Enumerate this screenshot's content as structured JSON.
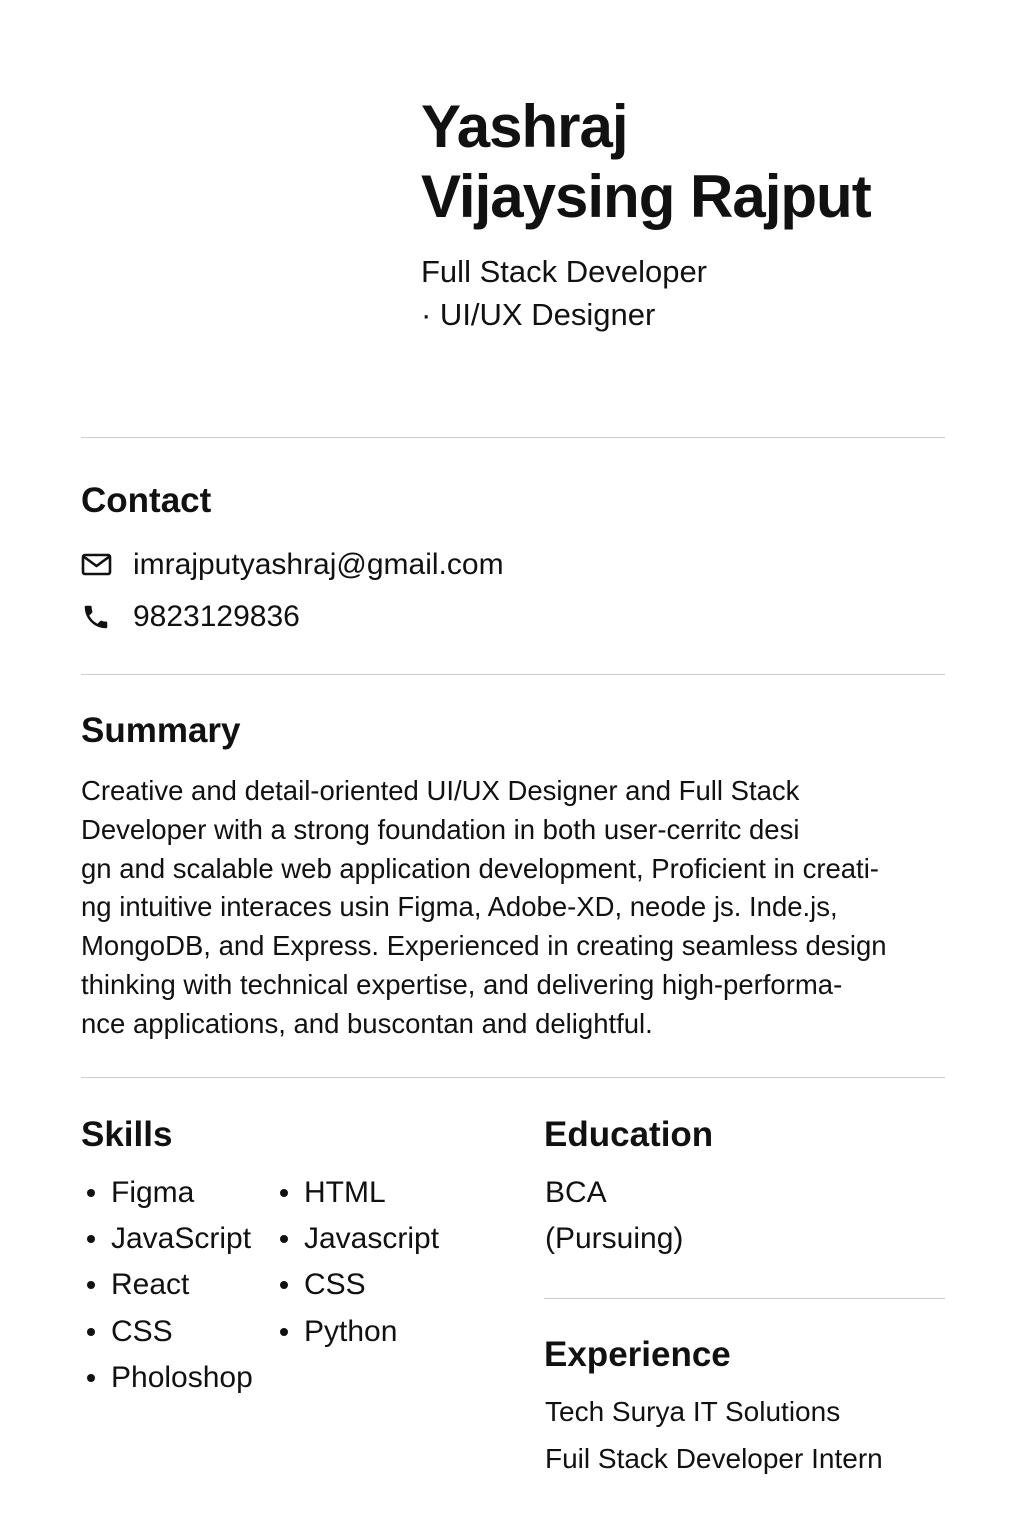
{
  "header": {
    "name_line1": "Yashraj",
    "name_line2": "Vijaysing Rajput",
    "title_line1": "Full Stack Developer",
    "title_line2": "· UI/UX Designer"
  },
  "contact": {
    "heading": "Contact",
    "email": "imrajputyashraj@gmail.com",
    "email_icon": "mail-icon",
    "phone": "9823129836",
    "phone_icon": "phone-icon"
  },
  "summary": {
    "heading": "Summary",
    "lines": [
      "Creative and detail-oriented UI/UX Designer and Full Stack",
      "Developer with a strong foundation in both user-cerritc desi",
      "gn and scalable web application development, Proficient in creati-",
      "ng intuitive interaces usin Figma, Adobe-XD, neode js. Inde.js,",
      "MongoDB, and Express. Experienced in creating seamless design",
      "thinking with technical expertise, and delivering high-performa-",
      "nce applications, and buscontan and delightful."
    ]
  },
  "skills": {
    "heading": "Skills",
    "col1": [
      "Figma",
      "JavaScript",
      "React",
      "CSS",
      "Pholoshop"
    ],
    "col2": [
      "HTML",
      "Javascript",
      "CSS",
      "Python"
    ]
  },
  "education": {
    "heading": "Education",
    "degree": "BCA",
    "status": "(Pursuing)"
  },
  "experience": {
    "heading": "Experience",
    "company": "Tech Surya IT Solutions",
    "role": "Fuil Stack Developer  Intern"
  }
}
